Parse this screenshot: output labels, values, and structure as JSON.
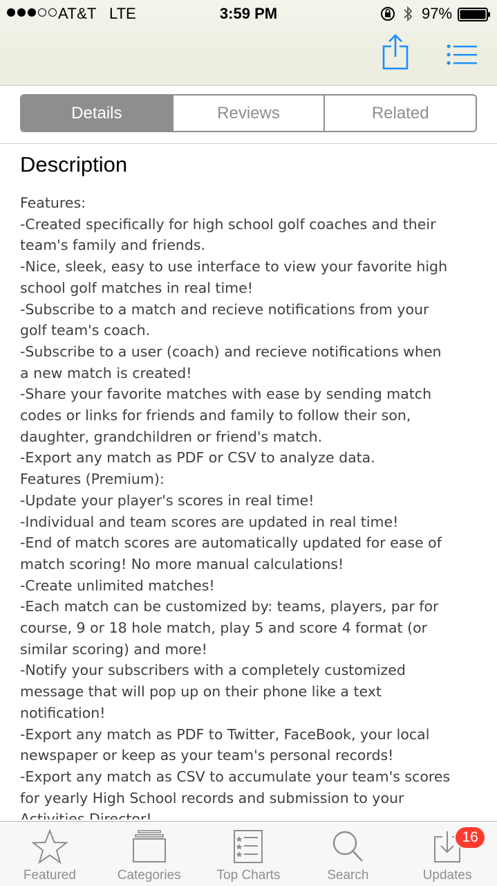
{
  "status_bar": {
    "carrier": "AT&T",
    "network": "LTE",
    "time": "3:59 PM",
    "battery_percent": "97%",
    "signal_strength": 3,
    "signal_total": 5
  },
  "header": {
    "share_icon": "share-icon",
    "list_icon": "list-icon"
  },
  "segments": [
    "Details",
    "Reviews",
    "Related"
  ],
  "active_segment": "Details",
  "description": {
    "heading": "Description",
    "lines": [
      "Features:",
      "-Created specifically for high school golf coaches and their",
      "team's family and friends.",
      "-Nice, sleek, easy to use interface to view your favorite high",
      "school golf matches in real time!",
      "-Subscribe to a match and recieve notifications from your",
      "golf team's coach.",
      "-Subscribe to a user (coach) and recieve notifications when",
      "a new match is created!",
      "-Share your favorite matches with ease by sending match",
      "codes or links for friends and family to follow their son,",
      "daughter, grandchildren or friend's match.",
      "-Export any match as PDF or CSV to analyze data.",
      "Features (Premium):",
      "-Update your player's scores in real time!",
      "-Individual and team scores are updated in real time!",
      "-End of match scores are automatically updated for ease of",
      "match scoring! No more manual calculations!",
      "-Create unlimited matches!",
      "-Each match can be customized by: teams, players, par for",
      "course, 9 or 18 hole match, play 5 and score 4 format (or",
      "similar scoring) and more!",
      "-Notify your subscribers with a completely customized",
      "message that will pop up on their phone like a text",
      "notification!",
      "-Export any match as PDF to Twitter, FaceBook, your local",
      "newspaper or keep as your team's personal records!",
      "-Export any match as CSV to accumulate your team's scores",
      "for yearly High School records and submission to your",
      "Activities Director!"
    ]
  },
  "tabs": [
    {
      "label": "Featured",
      "icon": "star-icon"
    },
    {
      "label": "Categories",
      "icon": "categories-icon"
    },
    {
      "label": "Top Charts",
      "icon": "top-charts-icon"
    },
    {
      "label": "Search",
      "icon": "search-icon"
    },
    {
      "label": "Updates",
      "icon": "updates-icon",
      "badge": "16"
    }
  ],
  "colors": {
    "accent": "#1a8cff",
    "segment_gray": "#8e8e8e",
    "badge_red": "#ff3b30",
    "body_text": "#3f3f3f"
  }
}
